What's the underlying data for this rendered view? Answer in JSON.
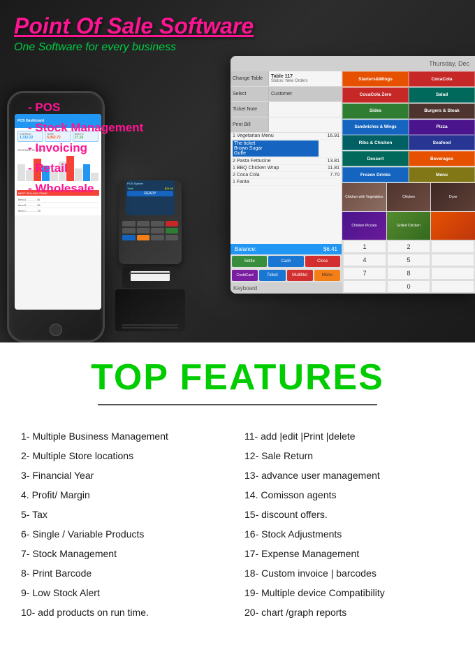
{
  "header": {
    "main_title": "Point Of Sale Software",
    "sub_title": "One Software for every business"
  },
  "features_list": [
    "- POS",
    "- Stock Management",
    "- Invoicing",
    "- Retail",
    "- Wholesale"
  ],
  "top_features_heading": "TOP FEATURES",
  "pos_app": {
    "header_time": "Thursday, Dec",
    "table_label": "Change Table",
    "table_value": "Table 117",
    "status": "Status: New Orders",
    "select_label": "Select",
    "customer_label": "Customer",
    "ticket_label": "Ticket Note",
    "print_bill_label": "Print Bill",
    "items": [
      {
        "name": "1 Vegetarian Menu",
        "price": "16.91"
      },
      {
        "name": "The ticket\nBrown Sugar\nGuffe",
        "price": ""
      },
      {
        "name": "2 Pasta Fettucine",
        "price": "13.81"
      },
      {
        "name": "1 BBQ Chicken Wrap",
        "price": "11.81"
      },
      {
        "name": "2 Coca Cola",
        "price": "7.70"
      },
      {
        "name": "1 Fanta",
        "price": ""
      }
    ],
    "balance_label": "Balance:",
    "balance_value": "$6.41",
    "buttons": {
      "settle": "Settle",
      "cash": "Cash",
      "close": "Close",
      "credit": "CreditCard",
      "ticket": "Ticket",
      "multinet": "MultiNet",
      "menu_btn": "Menu"
    },
    "menu_items": [
      {
        "label": "Starters&Wings",
        "class": "mb-orange"
      },
      {
        "label": "CocaCola",
        "class": "mb-red"
      },
      {
        "label": "CocaCola Zero",
        "class": "mb-red"
      },
      {
        "label": "Salad",
        "class": "mb-teal"
      },
      {
        "label": "Sides",
        "class": "mb-green"
      },
      {
        "label": "Burgers & Steak",
        "class": "mb-brown"
      },
      {
        "label": "Sandwiches & Wings",
        "class": "mb-blue"
      },
      {
        "label": "Pizza",
        "class": "mb-purple"
      },
      {
        "label": "Ribs & Chicken",
        "class": "mb-cyan"
      },
      {
        "label": "Seafood",
        "class": "mb-indigo"
      },
      {
        "label": "Dessert",
        "class": "mb-teal"
      },
      {
        "label": "Beverages",
        "class": "mb-orange"
      },
      {
        "label": "Frozen Drinks",
        "class": "mb-blue"
      },
      {
        "label": "Menu",
        "class": "mb-lime"
      }
    ],
    "keyboard_label": "Keyboard"
  },
  "left_features": [
    "1- Multiple Business Management",
    "2- Multiple Store locations",
    "3- Financial Year",
    "4. Profit/ Margin",
    "5- Tax",
    "6- Single / Variable Products",
    "7- Stock  Management",
    "8- Print Barcode",
    "9- Low Stock Alert",
    "10- add products on run time."
  ],
  "right_features": [
    "11- add |edit |Print  |delete",
    "12- Sale Return",
    "13- advance user management",
    "14. Comisson agents",
    "15- discount offers.",
    "16- Stock Adjustments",
    "17- Expense Management",
    "18- Custom invoice | barcodes",
    "19- Multiple device Compatibility",
    "20- chart /graph reports"
  ],
  "phone": {
    "stats": [
      {
        "label": "CURRENT",
        "value": "1,312.22"
      },
      {
        "label": "WEEK",
        "value": ""
      },
      {
        "label": "MONTH",
        "value": ""
      }
    ]
  }
}
